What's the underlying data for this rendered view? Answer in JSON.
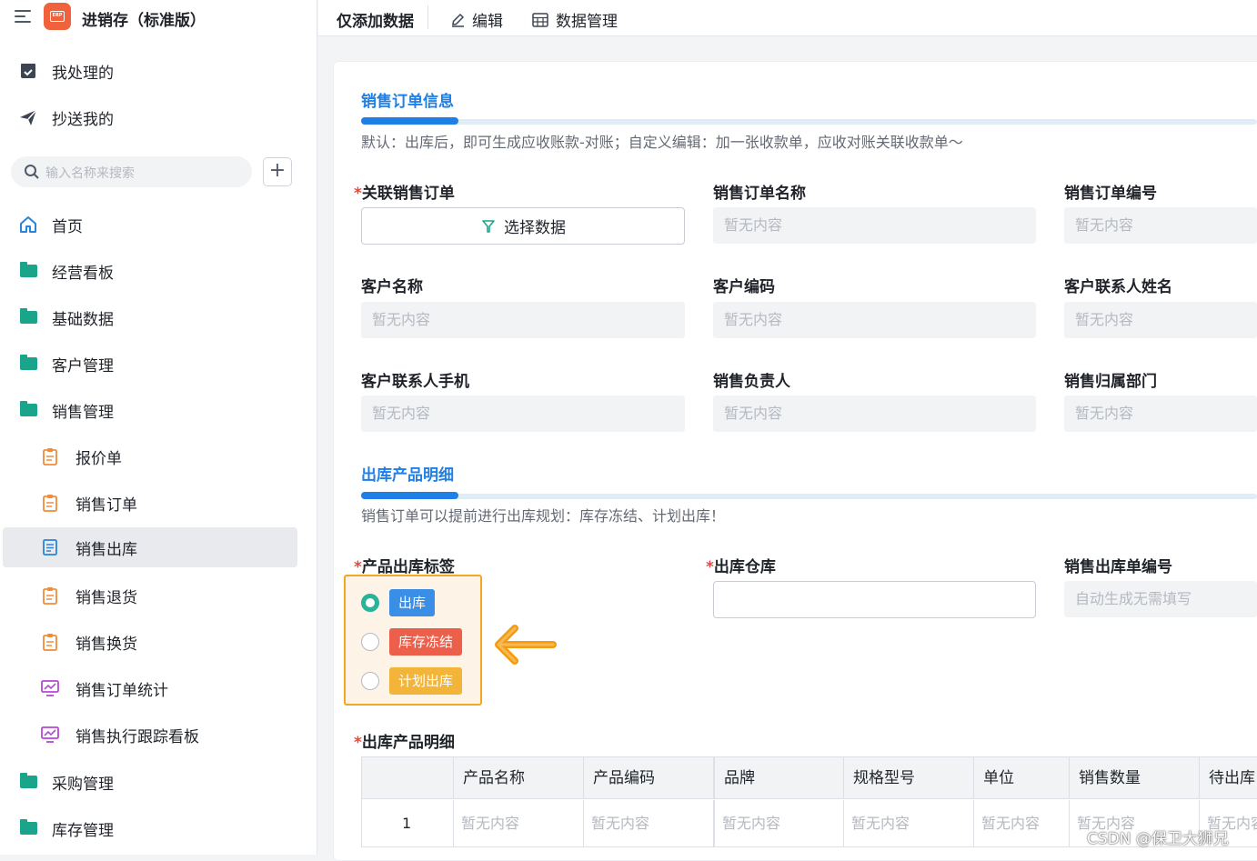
{
  "app": {
    "title": "进销存（标准版）"
  },
  "sidebar": {
    "quick": [
      {
        "label": "我处理的"
      },
      {
        "label": "抄送我的"
      }
    ],
    "search_placeholder": "输入名称来搜索",
    "add_symbol": "+",
    "items": [
      {
        "label": "首页"
      },
      {
        "label": "经营看板"
      },
      {
        "label": "基础数据"
      },
      {
        "label": "客户管理"
      },
      {
        "label": "销售管理"
      },
      {
        "label": "报价单"
      },
      {
        "label": "销售订单"
      },
      {
        "label": "销售出库"
      },
      {
        "label": "销售退货"
      },
      {
        "label": "销售换货"
      },
      {
        "label": "销售订单统计"
      },
      {
        "label": "销售执行跟踪看板"
      },
      {
        "label": "采购管理"
      },
      {
        "label": "库存管理"
      }
    ]
  },
  "toolbar": {
    "mode": "仅添加数据",
    "edit": "编辑",
    "data_manage": "数据管理"
  },
  "section1": {
    "title": "销售订单信息",
    "desc": "默认：出库后，即可生成应收账款-对账；自定义编辑：加一张收款单，应收对账关联收款单～",
    "fields": {
      "link_order": {
        "label": "关联销售订单",
        "button": "选择数据"
      },
      "order_name": {
        "label": "销售订单名称",
        "value": "暂无内容"
      },
      "order_no": {
        "label": "销售订单编号",
        "value": "暂无内容"
      },
      "customer_name": {
        "label": "客户名称",
        "value": "暂无内容"
      },
      "customer_code": {
        "label": "客户编码",
        "value": "暂无内容"
      },
      "contact_name": {
        "label": "客户联系人姓名",
        "value": "暂无内容"
      },
      "contact_phone": {
        "label": "客户联系人手机",
        "value": "暂无内容"
      },
      "sales_owner": {
        "label": "销售负责人",
        "value": "暂无内容"
      },
      "sales_dept": {
        "label": "销售归属部门",
        "value": "暂无内容"
      }
    }
  },
  "section2": {
    "title": "出库产品明细",
    "desc": "销售订单可以提前进行出库规划：库存冻结、计划出库！",
    "tag_label": "产品出库标签",
    "tags": [
      {
        "label": "出库",
        "color": "#3a8ee6",
        "selected": true
      },
      {
        "label": "库存冻结",
        "color": "#ec5f4a",
        "selected": false
      },
      {
        "label": "计划出库",
        "color": "#f2b53a",
        "selected": false
      }
    ],
    "warehouse_label": "出库仓库",
    "outbound_no_label": "销售出库单编号",
    "outbound_no_placeholder": "自动生成无需填写",
    "detail_label": "出库产品明细",
    "required_mark": "*",
    "table": {
      "headers": [
        "产品名称",
        "产品编码",
        "品牌",
        "规格型号",
        "单位",
        "销售数量",
        "待出库"
      ],
      "rows": [
        {
          "index": "1",
          "cells": [
            "暂无内容",
            "暂无内容",
            "暂无内容",
            "暂无内容",
            "暂无内容",
            "暂无内容",
            "暂无内容"
          ]
        }
      ]
    }
  },
  "watermark": "CSDN @保卫大狮兄"
}
